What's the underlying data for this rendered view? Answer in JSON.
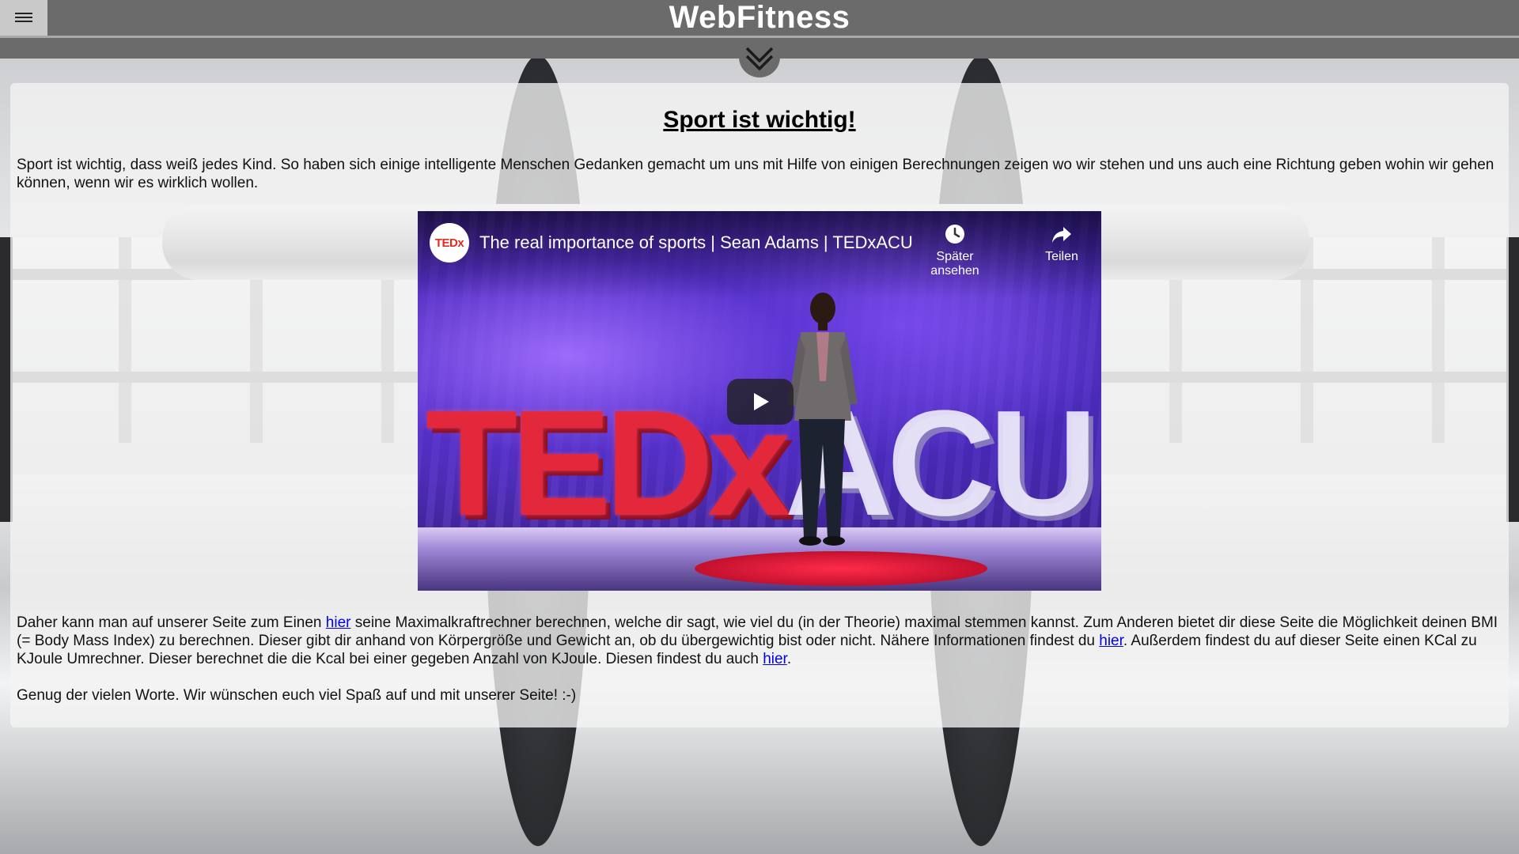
{
  "header": {
    "title": "WebFitness",
    "menu_icon": "hamburger-menu-icon",
    "scroll_icon": "double-chevron-down-icon"
  },
  "main": {
    "heading": "Sport ist wichtig!",
    "intro": "Sport ist wichtig, dass weiß jedes Kind. So haben sich einige intelligente Menschen Gedanken gemacht um uns mit Hilfe von einigen Berechnungen zeigen wo wir stehen und uns auch eine Richtung geben wohin wir gehen können, wenn wir es wirklich wollen.",
    "body": {
      "part1": "Daher kann man auf unserer Seite zum Einen ",
      "link1": "hier",
      "part2": " seine Maximalkraftrechner berechnen, welche dir sagt, wie viel du (in der Theorie) maximal stemmen kannst. Zum Anderen bietet dir diese Seite die Möglichkeit deinen BMI (= Body Mass Index) zu berechnen. Dieser gibt dir anhand von Körpergröße und Gewicht an, ob du übergewichtig bist oder nicht. Nähere Informationen findest du ",
      "link2": "hier",
      "part3": ". Außerdem findest du auf dieser Seite einen KCal zu KJoule Umrechner. Dieser berechnet die die Kcal bei einer gegeben Anzahl von KJoule. Diesen findest du auch ",
      "link3": "hier",
      "part4": "."
    },
    "closing": "Genug der vielen Worte. Wir wünschen euch viel Spaß auf und mit unserer Seite! :-)"
  },
  "video": {
    "channel_logo": "TEDx",
    "title": "The real importance of sports | Sean Adams | TEDxACU",
    "watch_later_label": "Später ansehen",
    "share_label": "Teilen",
    "watch_later_icon": "clock-icon",
    "share_icon": "share-arrow-icon",
    "play_icon": "play-icon",
    "stage_text_red": "TEDx",
    "stage_text_white": "ACU"
  },
  "colors": {
    "header_bg": "#6b6b6b",
    "link": "#0000ee",
    "card_bg": "rgba(244,244,244,0.78)"
  }
}
